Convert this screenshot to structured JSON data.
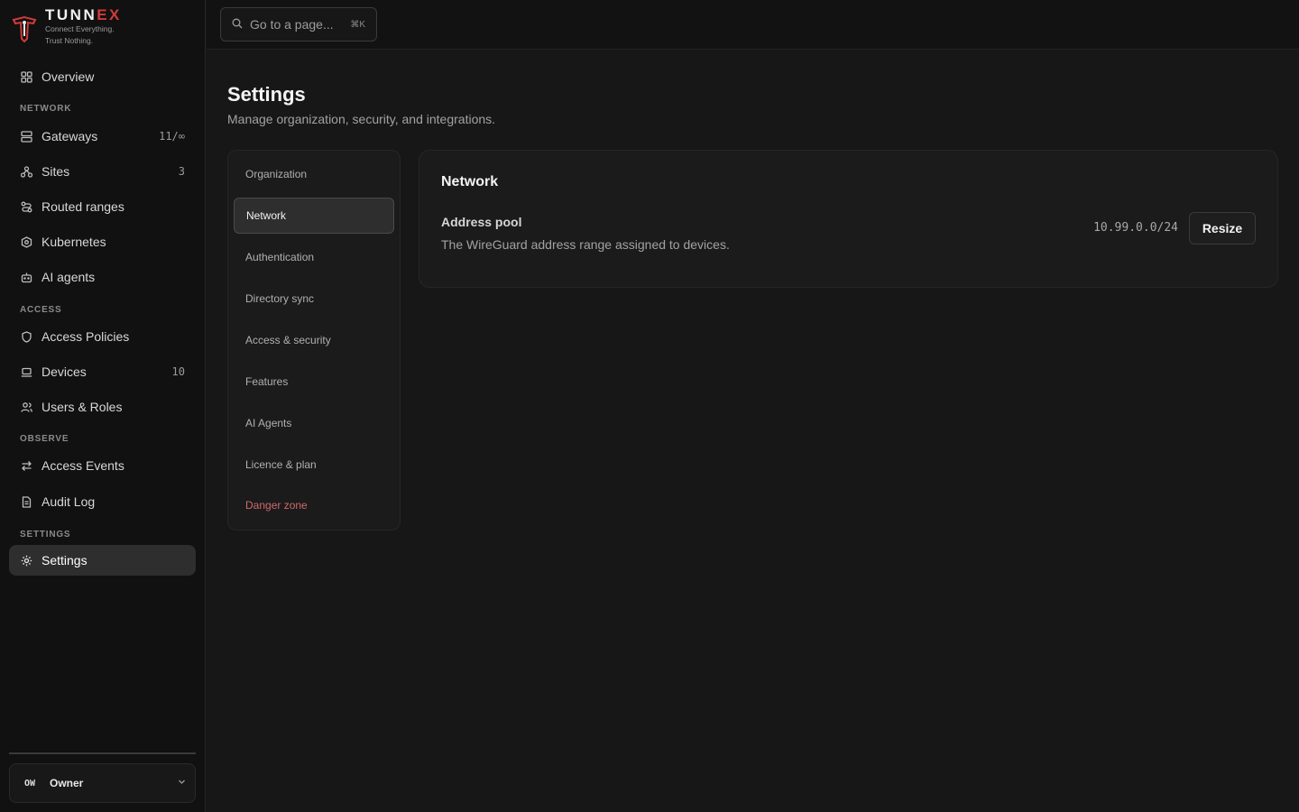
{
  "brand": {
    "name_main": "TUNN",
    "name_accent": "EX",
    "tagline_1": "Connect Everything.",
    "tagline_2": "Trust Nothing.",
    "accent_color": "#d23a3a"
  },
  "sidebar": {
    "overview": {
      "label": "Overview",
      "icon": "grid-icon"
    },
    "sections": {
      "network": "NETWORK",
      "access": "ACCESS",
      "observe": "OBSERVE",
      "settings": "SETTINGS"
    },
    "items": {
      "gateways": {
        "label": "Gateways",
        "count": "11/∞",
        "icon": "server-icon"
      },
      "sites": {
        "label": "Sites",
        "count": "3",
        "icon": "sites-icon"
      },
      "routed_ranges": {
        "label": "Routed ranges",
        "icon": "route-icon"
      },
      "kubernetes": {
        "label": "Kubernetes",
        "icon": "kubernetes-icon"
      },
      "ai_agents": {
        "label": "AI agents",
        "icon": "bot-icon"
      },
      "access_policies": {
        "label": "Access Policies",
        "icon": "shield-icon"
      },
      "devices": {
        "label": "Devices",
        "count": "10",
        "icon": "laptop-icon"
      },
      "users_roles": {
        "label": "Users & Roles",
        "icon": "users-icon"
      },
      "access_events": {
        "label": "Access Events",
        "icon": "arrows-icon"
      },
      "audit_log": {
        "label": "Audit Log",
        "icon": "document-icon"
      },
      "settings": {
        "label": "Settings",
        "icon": "gear-icon",
        "active": true
      }
    },
    "owner": {
      "initials": "OW",
      "name": "Owner"
    }
  },
  "topbar": {
    "search_placeholder": "Go to a page...",
    "search_shortcut": "⌘K"
  },
  "page": {
    "title": "Settings",
    "subtitle": "Manage organization, security, and integrations."
  },
  "settings_nav": {
    "tabs": [
      {
        "label": "Organization"
      },
      {
        "label": "Network",
        "active": true
      },
      {
        "label": "Authentication"
      },
      {
        "label": "Directory sync"
      },
      {
        "label": "Access & security"
      },
      {
        "label": "Features"
      },
      {
        "label": "AI Agents"
      },
      {
        "label": "Licence & plan"
      },
      {
        "label": "Danger zone",
        "danger": true
      }
    ]
  },
  "network_panel": {
    "title": "Network",
    "address_pool": {
      "label": "Address pool",
      "description": "The WireGuard address range assigned to devices.",
      "value": "10.99.0.0/24",
      "action": "Resize"
    }
  }
}
